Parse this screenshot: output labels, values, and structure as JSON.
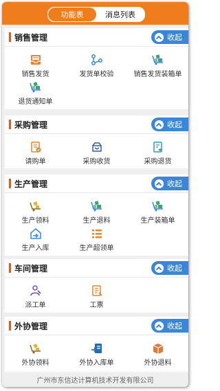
{
  "tabs": [
    {
      "label": "功能表",
      "active": true
    },
    {
      "label": "消息列表",
      "active": false
    }
  ],
  "collapse_label": "收起",
  "sections": [
    {
      "title": "销售管理",
      "items": [
        {
          "label": "销售发货",
          "icon": "inbox-tray-icon"
        },
        {
          "label": "发货单校验",
          "icon": "share-nodes-icon"
        },
        {
          "label": "销售发货装箱单",
          "icon": "boxes-dolly-icon"
        },
        {
          "label": "退货通知单",
          "icon": "boxes-dolly-icon"
        }
      ]
    },
    {
      "title": "采购管理",
      "items": [
        {
          "label": "请购单",
          "icon": "clipboard-check-icon"
        },
        {
          "label": "采购收货",
          "icon": "receive-tray-icon"
        },
        {
          "label": "采购退货",
          "icon": "return-document-icon"
        }
      ]
    },
    {
      "title": "生产管理",
      "items": [
        {
          "label": "生产领料",
          "icon": "cart-boxes-icon"
        },
        {
          "label": "生产退料",
          "icon": "boxes-dolly-icon"
        },
        {
          "label": "生产装箱单",
          "icon": "boxes-dolly-icon"
        },
        {
          "label": "生产入库",
          "icon": "warehouse-in-icon"
        },
        {
          "label": "生产超领单",
          "icon": "list-icon"
        }
      ]
    },
    {
      "title": "车间管理",
      "items": [
        {
          "label": "派工单",
          "icon": "worker-icon"
        },
        {
          "label": "工票",
          "icon": "ticket-doc-icon"
        }
      ]
    },
    {
      "title": "外协管理",
      "items": [
        {
          "label": "外协领料",
          "icon": "cart-boxes-icon"
        },
        {
          "label": "外协入库单",
          "icon": "doc-in-icon"
        },
        {
          "label": "外协退料",
          "icon": "box-return-icon"
        }
      ]
    }
  ],
  "footer": "广州市东信达计算机技术开发有限公司",
  "colors": {
    "header": "#ef7d1c",
    "accent_blue": "#3a87d9",
    "section_bar": "#e2591c"
  }
}
